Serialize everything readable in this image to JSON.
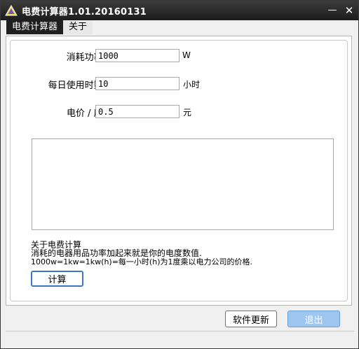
{
  "window": {
    "title": "电费计算器1.01.20160131",
    "minimize_label": "—",
    "close_label": "✕"
  },
  "tabs": [
    {
      "label": "电费计算器",
      "active": true
    },
    {
      "label": "关于",
      "active": false
    }
  ],
  "form": {
    "power": {
      "label": "消耗功率:",
      "value": "1000",
      "unit": "W"
    },
    "hours": {
      "label": "每日使用时数:",
      "value": "10",
      "unit": "小时"
    },
    "price": {
      "label": "电价 / 度:",
      "value": "0.5",
      "unit": "元"
    }
  },
  "output": {
    "value": ""
  },
  "info": {
    "title": "关于电费计算",
    "line1": "消耗的电器用品功率加起来就是你的电度数值.",
    "line2": "1000w=1kw=1kw(h)=每一小时(h)为1度乘以电力公司的价格."
  },
  "buttons": {
    "calculate": "计算",
    "update": "软件更新",
    "exit": "退出"
  },
  "colors": {
    "titlebar": "#1c1c1c",
    "active_tab": "#1f1f1f",
    "accent_border": "#3c78c8",
    "exit_button": "#9fc6ef"
  }
}
